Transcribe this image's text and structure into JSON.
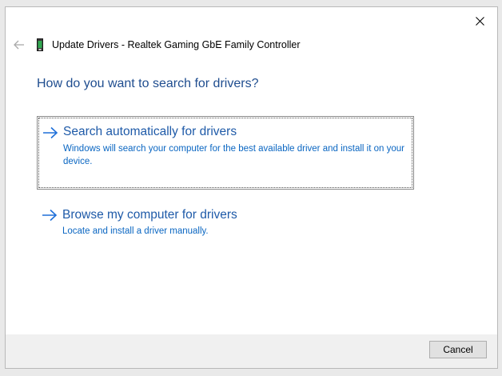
{
  "window": {
    "title": "Update Drivers - Realtek Gaming GbE Family Controller"
  },
  "heading": "How do you want to search for drivers?",
  "options": [
    {
      "title": "Search automatically for drivers",
      "description": "Windows will search your computer for the best available driver and install it on your device."
    },
    {
      "title": "Browse my computer for drivers",
      "description": "Locate and install a driver manually."
    }
  ],
  "footer": {
    "cancel_label": "Cancel"
  },
  "icons": {
    "back": "back-arrow-icon",
    "close": "close-icon",
    "device": "network-adapter-icon",
    "option_arrow": "right-arrow-icon"
  },
  "colors": {
    "heading": "#1f4d8f",
    "option_title": "#1e5aa8",
    "option_desc": "#0a66c2",
    "arrow": "#1e6fd9"
  }
}
